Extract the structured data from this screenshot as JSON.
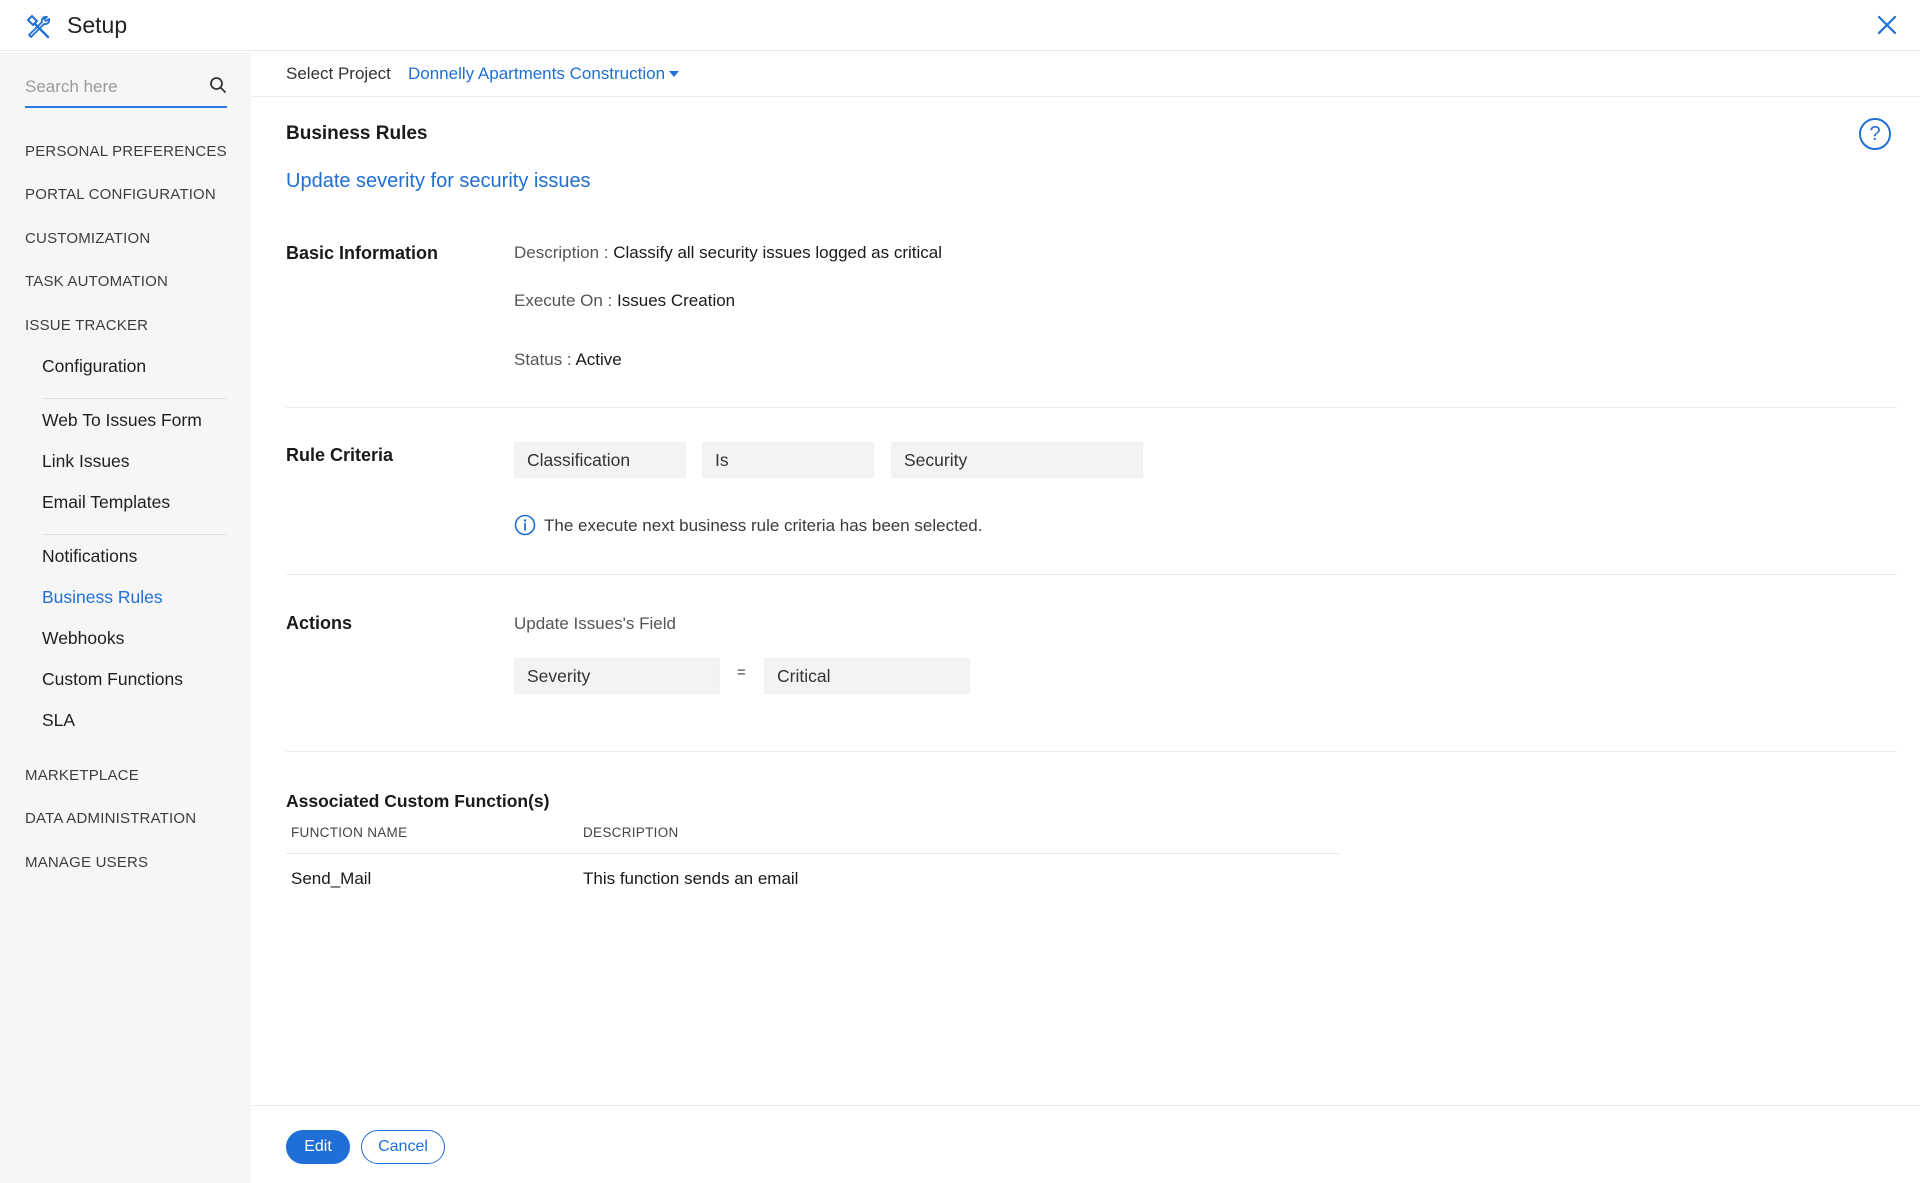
{
  "app": {
    "title": "Setup"
  },
  "search": {
    "placeholder": "Search here"
  },
  "sidebar": {
    "sections": [
      "PERSONAL PREFERENCES",
      "PORTAL CONFIGURATION",
      "CUSTOMIZATION",
      "TASK AUTOMATION",
      "ISSUE TRACKER",
      "MARKETPLACE",
      "DATA ADMINISTRATION",
      "MANAGE USERS"
    ],
    "issue_tracker_items": [
      "Configuration",
      "Web To Issues Form",
      "Link Issues",
      "Email Templates",
      "Notifications",
      "Business Rules",
      "Webhooks",
      "Custom Functions",
      "SLA"
    ]
  },
  "project": {
    "label": "Select Project",
    "selected": "Donnelly Apartments Construction"
  },
  "page": {
    "title": "Business Rules",
    "help": "?",
    "rule_name": "Update severity for security issues"
  },
  "basic_info": {
    "label": "Basic Information",
    "description_key": "Description :",
    "description_value": "Classify all security issues logged as critical",
    "execute_key": "Execute On :",
    "execute_value": "Issues Creation",
    "status_key": "Status :",
    "status_value": "Active"
  },
  "rule_criteria": {
    "label": "Rule Criteria",
    "field": "Classification",
    "operator": "Is",
    "value": "Security",
    "note": "The execute next business rule criteria has been selected."
  },
  "actions": {
    "label": "Actions",
    "subtitle": "Update Issues's Field",
    "field": "Severity",
    "operator": "=",
    "value": "Critical"
  },
  "associated": {
    "title": "Associated Custom Function(s)",
    "columns": [
      "FUNCTION NAME",
      "DESCRIPTION"
    ],
    "rows": [
      {
        "name": "Send_Mail",
        "description": "This function sends an email"
      }
    ]
  },
  "footer": {
    "edit": "Edit",
    "cancel": "Cancel"
  },
  "colors": {
    "accent": "#1f6fd6",
    "sidebar_bg": "#f6f6f6"
  }
}
